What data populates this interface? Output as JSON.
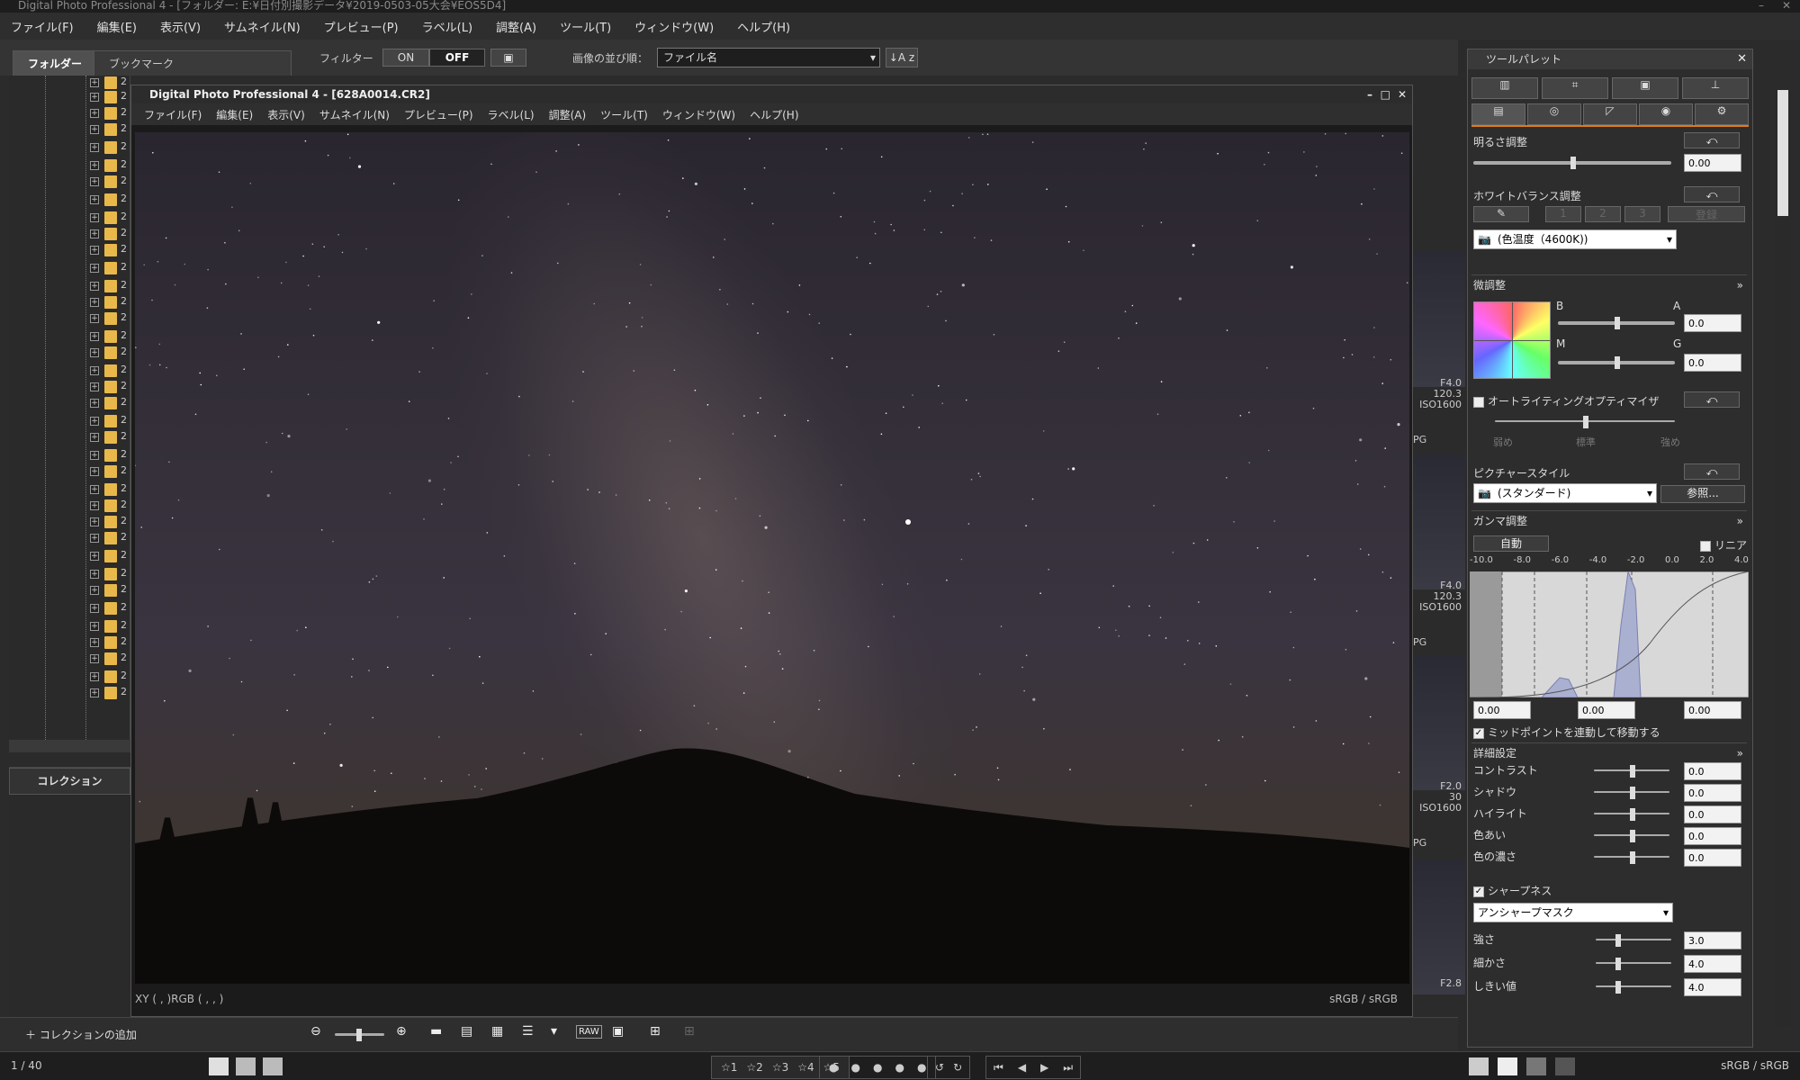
{
  "app": {
    "title": "Digital Photo Professional 4 - [フォルダー: E:¥日付別撮影データ¥2019-0503-05大会¥EOS5D4]"
  },
  "menu": [
    "ファイル(F)",
    "編集(E)",
    "表示(V)",
    "サムネイル(N)",
    "プレビュー(P)",
    "ラベル(L)",
    "調整(A)",
    "ツール(T)",
    "ウィンドウ(W)",
    "ヘルプ(H)"
  ],
  "tabs": {
    "folder": "フォルダー",
    "bookmark": "ブックマーク"
  },
  "filter": {
    "label": "フィルター",
    "on": "ON",
    "off": "OFF"
  },
  "sort": {
    "label": "画像の並び順：",
    "value": "ファイル名",
    "az": "↓A z"
  },
  "tree_number": "2",
  "collection": {
    "title": "コレクション",
    "add": "コレクションの追加"
  },
  "window": {
    "title": "Digital Photo Professional 4 - [628A0014.CR2]",
    "menu": [
      "ファイル(F)",
      "編集(E)",
      "表示(V)",
      "サムネイル(N)",
      "プレビュー(P)",
      "ラベル(L)",
      "調整(A)",
      "ツール(T)",
      "ウィンドウ(W)",
      "ヘルプ(H)"
    ],
    "status_left": "XY (     ,     )RGB (     ,     ,     )",
    "status_right": "sRGB / sRGB"
  },
  "thumbs": [
    {
      "line1": "F4.0",
      "line2": "120.3",
      "line3": "ISO1600",
      "ext": "PG"
    },
    {
      "line1": "F4.0",
      "line2": "120.3",
      "line3": "ISO1600",
      "ext": "PG"
    },
    {
      "line1": "F2.0",
      "line2": "30",
      "line3": "ISO1600",
      "ext": "PG"
    },
    {
      "line1": "F2.8",
      "line2": "",
      "line3": "",
      "ext": ""
    }
  ],
  "palette": {
    "title": "ツールパレット",
    "brightness": {
      "label": "明るさ調整",
      "value": "0.00"
    },
    "wb": {
      "label": "ホワイトバランス調整",
      "preset": "(色温度（4600K))",
      "slots": [
        "1",
        "2",
        "3"
      ],
      "register": "登録"
    },
    "fine": {
      "label": "微調整",
      "b": "B",
      "a": "A",
      "m": "M",
      "g": "G",
      "ba_value": "0.0",
      "mg_value": "0.0"
    },
    "alo": {
      "label": "オートライティングオプティマイザ",
      "low": "弱め",
      "std": "標準",
      "high": "強め"
    },
    "picstyle": {
      "label": "ピクチャースタイル",
      "value": "(スタンダード)",
      "browse": "参照..."
    },
    "gamma": {
      "label": "ガンマ調整",
      "auto": "自動",
      "linear": "リニア",
      "ticks": [
        "-10.0",
        "-8.0",
        "-6.0",
        "-4.0",
        "-2.0",
        "0.0",
        "2.0",
        "4.0"
      ],
      "v1": "0.00",
      "v2": "0.00",
      "v3": "0.00",
      "midpoint": "ミッドポイントを連動して移動する"
    },
    "detail": {
      "label": "詳細設定",
      "rows": [
        {
          "label": "コントラスト",
          "value": "0.0"
        },
        {
          "label": "シャドウ",
          "value": "0.0"
        },
        {
          "label": "ハイライト",
          "value": "0.0"
        },
        {
          "label": "色あい",
          "value": "0.0"
        },
        {
          "label": "色の濃さ",
          "value": "0.0"
        }
      ]
    },
    "sharp": {
      "label": "シャープネス",
      "mode": "アンシャープマスク",
      "rows": [
        {
          "label": "強さ",
          "value": "3.0"
        },
        {
          "label": "細かさ",
          "value": "4.0"
        },
        {
          "label": "しきい値",
          "value": "4.0"
        }
      ]
    }
  },
  "footer": {
    "count": "1 / 40",
    "colorspace": "sRGB / sRGB"
  },
  "footer_ratings": [
    "1",
    "2",
    "3",
    "4",
    "5"
  ]
}
